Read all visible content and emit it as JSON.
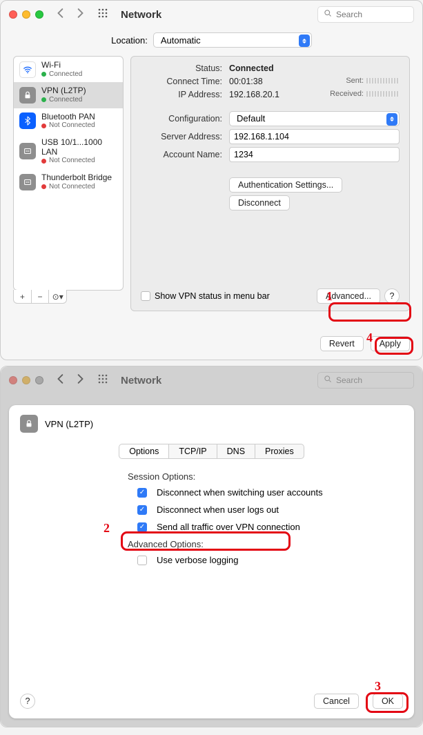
{
  "window1": {
    "title": "Network",
    "search_placeholder": "Search",
    "location_label": "Location:",
    "location_value": "Automatic",
    "sidebar": [
      {
        "name": "Wi-Fi",
        "status": "Connected",
        "color": "g",
        "icon": "wifi"
      },
      {
        "name": "VPN (L2TP)",
        "status": "Connected",
        "color": "g",
        "icon": "lock",
        "selected": true
      },
      {
        "name": "Bluetooth PAN",
        "status": "Not Connected",
        "color": "r",
        "icon": "bt"
      },
      {
        "name": "USB 10/1...1000 LAN",
        "status": "Not Connected",
        "color": "r",
        "icon": "eth"
      },
      {
        "name": "Thunderbolt Bridge",
        "status": "Not Connected",
        "color": "r",
        "icon": "eth"
      }
    ],
    "list_buttons": {
      "add": "+",
      "remove": "−",
      "more": "⊙▾"
    },
    "detail": {
      "status_label": "Status:",
      "status_value": "Connected",
      "connect_time_label": "Connect Time:",
      "connect_time_value": "00:01:38",
      "ip_label": "IP Address:",
      "ip_value": "192.168.20.1",
      "sent_label": "Sent:",
      "received_label": "Received:",
      "config_label": "Configuration:",
      "config_value": "Default",
      "server_label": "Server Address:",
      "server_value": "192.168.1.104",
      "account_label": "Account Name:",
      "account_value": "1234",
      "auth_btn": "Authentication Settings...",
      "disconnect_btn": "Disconnect",
      "show_vpn_label": "Show VPN status in menu bar",
      "advanced_btn": "Advanced...",
      "help_btn": "?"
    },
    "footer": {
      "revert": "Revert",
      "apply": "Apply"
    },
    "annotations": {
      "n1": "1",
      "n4": "4"
    }
  },
  "window2": {
    "title": "Network",
    "search_placeholder": "Search",
    "sheet": {
      "iface_name": "VPN (L2TP)",
      "tabs": [
        "Options",
        "TCP/IP",
        "DNS",
        "Proxies"
      ],
      "session_hdr": "Session Options:",
      "opt1": "Disconnect when switching user accounts",
      "opt2": "Disconnect when user logs out",
      "opt3": "Send all traffic over VPN connection",
      "advanced_hdr": "Advanced Options:",
      "opt4": "Use verbose logging",
      "help_btn": "?",
      "cancel": "Cancel",
      "ok": "OK"
    },
    "annotations": {
      "n2": "2",
      "n3": "3"
    }
  }
}
